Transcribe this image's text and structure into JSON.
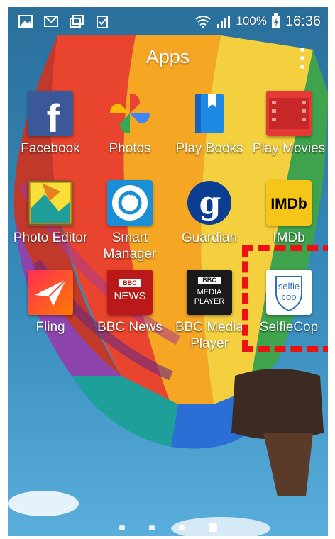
{
  "status_bar": {
    "battery": "100%",
    "time": "16:36",
    "left_icons": [
      "gallery-icon",
      "mail-icon",
      "multi-window-icon",
      "clipboard-check-icon"
    ],
    "right_icons": [
      "wifi-icon",
      "signal-icon",
      "battery-charging-icon"
    ]
  },
  "header": {
    "title": "Apps"
  },
  "apps": [
    {
      "label": "Facebook",
      "icon": "facebook-icon"
    },
    {
      "label": "Photos",
      "icon": "photos-icon"
    },
    {
      "label": "Play Books",
      "icon": "play-books-icon"
    },
    {
      "label": "Play Movies",
      "icon": "play-movies-icon"
    },
    {
      "label": "Photo Editor",
      "icon": "photo-editor-icon"
    },
    {
      "label": "Smart Manager",
      "icon": "smart-manager-icon"
    },
    {
      "label": "Guardian",
      "icon": "guardian-icon"
    },
    {
      "label": "IMDb",
      "icon": "imdb-icon"
    },
    {
      "label": "Fling",
      "icon": "fling-icon"
    },
    {
      "label": "BBC News",
      "icon": "bbc-news-icon"
    },
    {
      "label": "BBC Media Player",
      "icon": "bbc-media-player-icon"
    },
    {
      "label": "SelfieCop",
      "icon": "selfiecop-icon"
    }
  ],
  "icon_text": {
    "facebook": "f",
    "guardian": "g",
    "imdb": "IMDb",
    "bbc": "BBC",
    "news": "NEWS",
    "media": "MEDIA",
    "player": "PLAYER",
    "selfie": "selfie",
    "cop": "cop"
  },
  "page_indicator": {
    "count": 4,
    "active": 4
  },
  "colors": {
    "highlight": "#ee1111",
    "sky": "#2f7fb0"
  }
}
